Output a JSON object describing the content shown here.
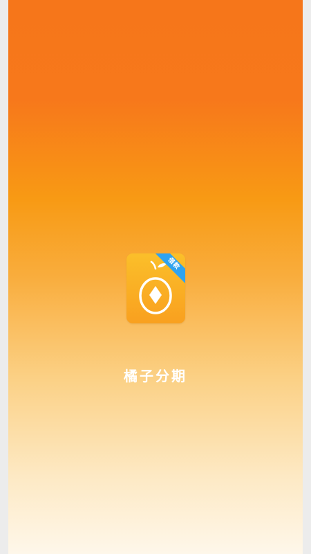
{
  "app": {
    "name": "橘子分期",
    "badge": "借款"
  },
  "icon": {
    "semantic": "orange-coin-logo-icon",
    "accent_color": "#2fa3f0",
    "primary_color": "#f9a01f"
  },
  "theme": {
    "gradient_top": "#f6761a",
    "gradient_bottom": "#fef7ea"
  }
}
